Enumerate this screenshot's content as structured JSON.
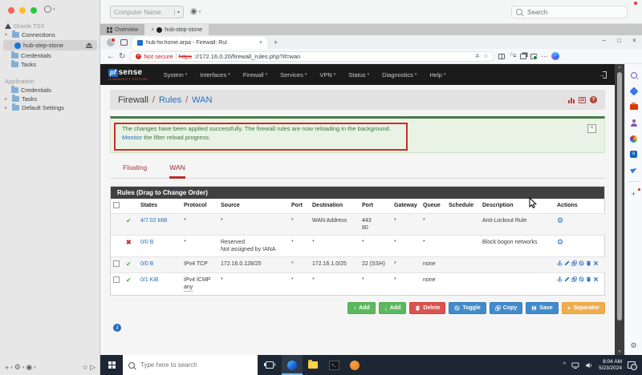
{
  "icons": {
    "caret_down": "▾",
    "expanded": "▾",
    "collapsed": "▸",
    "close": "×",
    "minimize": "−",
    "maximize": "□",
    "back": "←",
    "refresh": "↻",
    "more": "⋯",
    "plus": "+",
    "pass": "✔",
    "block": "✖",
    "gear": "⚙",
    "star": "☆",
    "play": "▷",
    "record": "◉",
    "help": "?",
    "info": "i",
    "arrow_up": "↑",
    "arrow_down": "↓",
    "arrow_right": "→",
    "read_aloud": "A",
    "caret_up": "^",
    "tri_up": "▲",
    "tri_down": "▼"
  },
  "royal": {
    "title": "Oracle TSX",
    "tree": {
      "connections": "Connections",
      "session": "hub-step-stone",
      "conn_items": [
        "Credentials",
        "Tasks"
      ],
      "application": "Application",
      "app_items": [
        "Credentials",
        "Tasks",
        "Default Settings"
      ]
    },
    "toolbar": {
      "computer_name": "Computer Name",
      "search_placeholder": "Search"
    },
    "tabs": {
      "overview": "Overview",
      "session": "hub-step-stone"
    }
  },
  "browser": {
    "tab_title": "hub-fw.home.arpa - Firewall: Rul",
    "not_secure": "Not secure",
    "url_scheme": "https",
    "url_rest": "://172.16.0.20/firewall_rules.php?if=wan"
  },
  "pfsense": {
    "brand": {
      "pf": "pf",
      "sense": "sense",
      "edition": "COMMUNITY EDITION"
    },
    "nav": [
      "System",
      "Interfaces",
      "Firewall",
      "Services",
      "VPN",
      "Status",
      "Diagnostics",
      "Help"
    ],
    "breadcrumb": {
      "section": "Firewall",
      "sep": "/",
      "page": "Rules",
      "iface": "WAN"
    },
    "alert": {
      "line1": "The changes have been applied successfully. The firewall rules are now reloading in the background.",
      "link": "Monitor",
      "line2": " the filter reload progress."
    },
    "tabs": {
      "floating": "Floating",
      "wan": "WAN"
    },
    "panel_title": "Rules (Drag to Change Order)",
    "columns": [
      "States",
      "Protocol",
      "Source",
      "Port",
      "Destination",
      "Port",
      "Gateway",
      "Queue",
      "Schedule",
      "Description",
      "Actions"
    ],
    "rules": [
      {
        "states": "4/7.02 MiB",
        "protocol": "*",
        "source": "*",
        "sport": "*",
        "destination": "WAN Address",
        "dport": "443",
        "dport2": "80",
        "gateway": "*",
        "queue": "*",
        "schedule": "",
        "description": "Anti-Lockout Rule"
      },
      {
        "states": "0/0 B",
        "protocol": "*",
        "source": "Reserved",
        "source2": "Not assigned by IANA",
        "sport": "*",
        "destination": "*",
        "dport": "*",
        "gateway": "*",
        "queue": "*",
        "schedule": "",
        "description": "Block bogon networks"
      },
      {
        "states": "0/0 B",
        "protocol": "IPv4 TCP",
        "source": "172.16.0.128/25",
        "sport": "*",
        "destination": "172.16.1.0/25",
        "dport": "22 (SSH)",
        "gateway": "*",
        "queue": "none",
        "schedule": "",
        "description": ""
      },
      {
        "states": "0/1 KiB",
        "protocol": "IPv4 ICMP",
        "protocol2": "any",
        "source": "*",
        "sport": "*",
        "destination": "*",
        "dport": "*",
        "gateway": "*",
        "queue": "none",
        "schedule": "",
        "description": ""
      }
    ],
    "buttons": {
      "add_top": "Add",
      "add_bottom": "Add",
      "delete": "Delete",
      "toggle": "Toggle",
      "copy": "Copy",
      "save": "Save",
      "separator": "Separator"
    }
  },
  "taskbar": {
    "search_placeholder": "Type here to search",
    "time": "8:04 AM",
    "date": "5/23/2024"
  }
}
